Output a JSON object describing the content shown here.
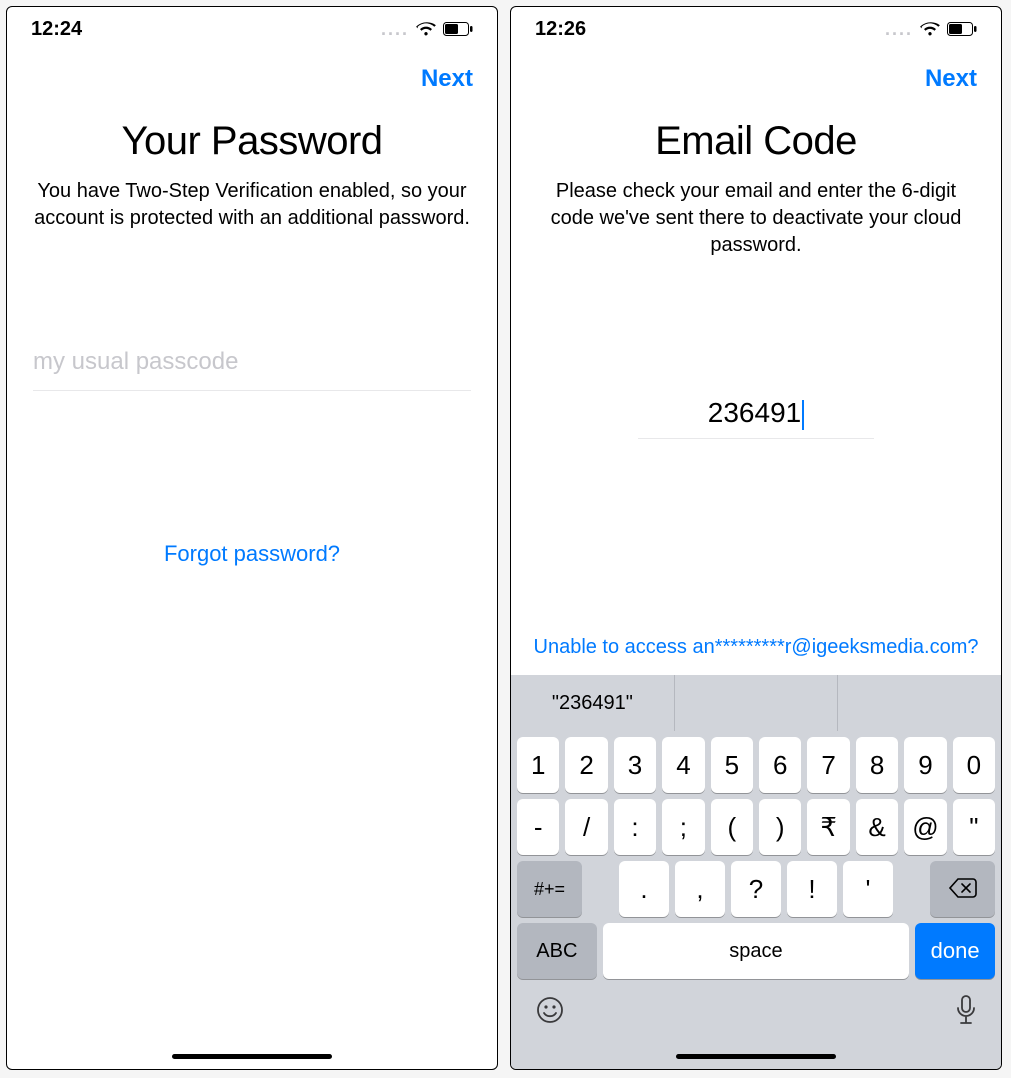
{
  "left": {
    "status": {
      "time": "12:24"
    },
    "nav": {
      "next": "Next"
    },
    "title": "Your Password",
    "subtitle": "You have Two-Step Verification enabled, so your account is protected with an additional password.",
    "input": {
      "placeholder": "my usual passcode",
      "value": ""
    },
    "forgot": "Forgot password?"
  },
  "right": {
    "status": {
      "time": "12:26"
    },
    "nav": {
      "next": "Next"
    },
    "title": "Email Code",
    "subtitle": "Please check your email and enter the 6-digit code we've sent there to deactivate your cloud password.",
    "code": "236491",
    "unable": "Unable to access an*********r@igeeksmedia.com?",
    "keyboard": {
      "suggestion": "\"236491\"",
      "row1": [
        "1",
        "2",
        "3",
        "4",
        "5",
        "6",
        "7",
        "8",
        "9",
        "0"
      ],
      "row2": [
        "-",
        "/",
        ":",
        ";",
        "(",
        ")",
        "₹",
        "&",
        "@",
        "\""
      ],
      "row3": {
        "alt": "#+=",
        "keys": [
          ".",
          ",",
          "?",
          "!",
          "'"
        ]
      },
      "row4": {
        "abc": "ABC",
        "space": "space",
        "done": "done"
      }
    }
  }
}
